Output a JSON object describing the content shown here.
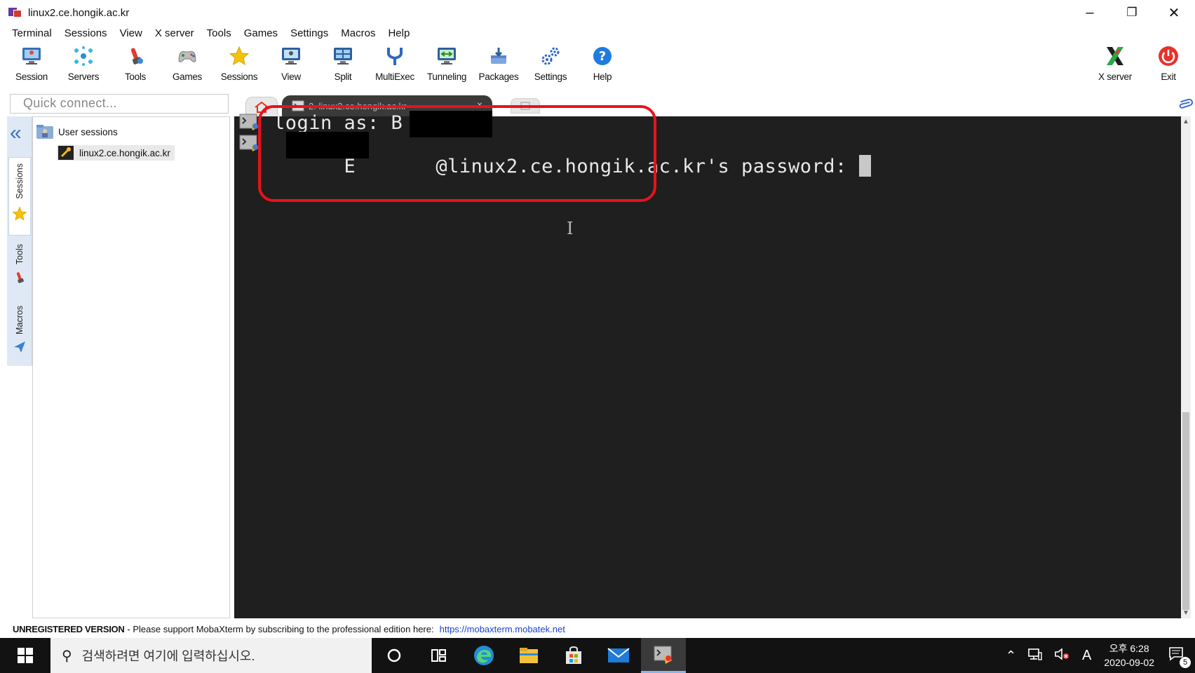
{
  "window": {
    "title": "linux2.ce.hongik.ac.kr",
    "controls": {
      "minimize": "–",
      "restore": "❐",
      "close": "✕"
    }
  },
  "menu": [
    "Terminal",
    "Sessions",
    "View",
    "X server",
    "Tools",
    "Games",
    "Settings",
    "Macros",
    "Help"
  ],
  "toolbar": {
    "items": [
      {
        "label": "Session",
        "icon": "session-monitor-icon"
      },
      {
        "label": "Servers",
        "icon": "servers-icon"
      },
      {
        "label": "Tools",
        "icon": "tools-icon"
      },
      {
        "label": "Games",
        "icon": "gamepad-icon"
      },
      {
        "label": "Sessions",
        "icon": "star-icon"
      },
      {
        "label": "View",
        "icon": "view-monitor-icon"
      },
      {
        "label": "Split",
        "icon": "split-icon"
      },
      {
        "label": "MultiExec",
        "icon": "fork-icon"
      },
      {
        "label": "Tunneling",
        "icon": "tunnel-icon"
      },
      {
        "label": "Packages",
        "icon": "package-icon"
      },
      {
        "label": "Settings",
        "icon": "gears-icon"
      },
      {
        "label": "Help",
        "icon": "help-icon"
      }
    ],
    "right": [
      {
        "label": "X server",
        "icon": "x-server-icon"
      },
      {
        "label": "Exit",
        "icon": "power-icon"
      }
    ]
  },
  "quick_connect": {
    "placeholder": "Quick connect..."
  },
  "tabs": {
    "active_label": "2. linux2.ce.hongik.ac.kr",
    "close": "×"
  },
  "side_tabs": [
    "Sessions",
    "Tools",
    "Macros"
  ],
  "sessions_tree": {
    "root": "User sessions",
    "items": [
      "linux2.ce.hongik.ac.kr"
    ]
  },
  "terminal": {
    "line1": "login as: B",
    "line2_prefix": "E",
    "line2_rest": "@linux2.ce.hongik.ac.kr's password: "
  },
  "status_bar": {
    "unregistered": "UNREGISTERED VERSION",
    "message": " -  Please support MobaXterm by subscribing to the professional edition here:",
    "link": "https://mobaxterm.mobatek.net"
  },
  "taskbar": {
    "search_placeholder": "검색하려면 여기에 입력하십시오.",
    "time": "오후 6:28",
    "date": "2020-09-02",
    "ime": "A",
    "notification_count": "5"
  },
  "colors": {
    "terminal_bg": "#1f1f1f",
    "highlight_red": "#e8121c",
    "link_blue": "#1a3fd1",
    "accent_blue": "#3773c4"
  }
}
